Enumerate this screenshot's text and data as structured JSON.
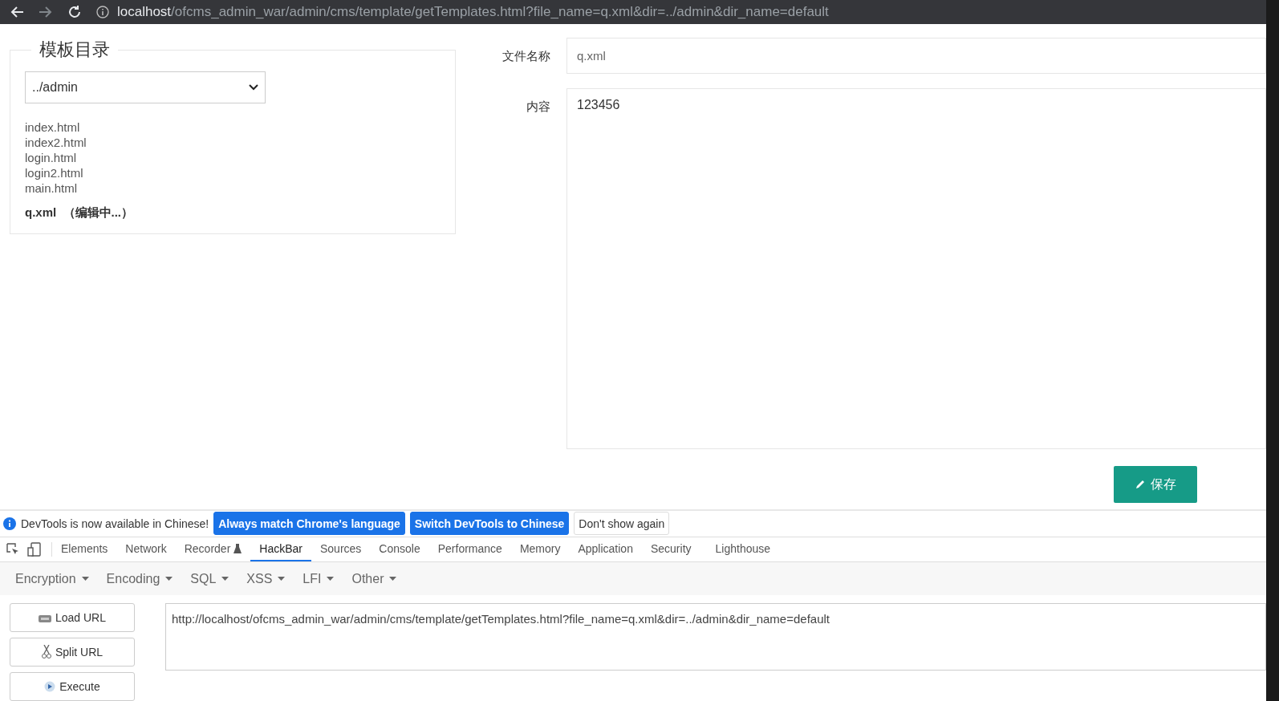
{
  "browser": {
    "url_host": "localhost",
    "url_path": "/ofcms_admin_war/admin/cms/template/getTemplates.html?file_name=q.xml&dir=../admin&dir_name=default"
  },
  "directory_panel": {
    "title": "模板目录",
    "dir_select": "../admin",
    "files": [
      {
        "name": "index.html",
        "editing": false
      },
      {
        "name": "index2.html",
        "editing": false
      },
      {
        "name": "login.html",
        "editing": false
      },
      {
        "name": "login2.html",
        "editing": false
      },
      {
        "name": "main.html",
        "editing": false
      },
      {
        "name": "q.xml",
        "editing": true,
        "status": "（编辑中...）"
      }
    ]
  },
  "editor": {
    "file_name_label": "文件名称",
    "file_name": "q.xml",
    "content_label": "内容",
    "content": "123456",
    "save_button": "保存"
  },
  "devtools": {
    "notice": {
      "text": "DevTools is now available in Chinese!",
      "buttons": [
        {
          "label": "Always match Chrome's language",
          "kind": "primary"
        },
        {
          "label": "Switch DevTools to Chinese",
          "kind": "primary"
        },
        {
          "label": "Don't show again",
          "kind": "plain"
        }
      ]
    },
    "tabs": [
      {
        "label": "Elements",
        "selected": false,
        "experimental": false
      },
      {
        "label": "Network",
        "selected": false,
        "experimental": false
      },
      {
        "label": "Recorder",
        "selected": false,
        "experimental": true
      },
      {
        "label": "HackBar",
        "selected": true,
        "experimental": false
      },
      {
        "label": "Sources",
        "selected": false,
        "experimental": false
      },
      {
        "label": "Console",
        "selected": false,
        "experimental": false
      },
      {
        "label": "Performance",
        "selected": false,
        "experimental": false
      },
      {
        "label": "Memory",
        "selected": false,
        "experimental": false
      },
      {
        "label": "Application",
        "selected": false,
        "experimental": false
      },
      {
        "label": "Security",
        "selected": false,
        "experimental": false
      },
      {
        "label": "Lighthouse",
        "selected": false,
        "experimental": false
      }
    ],
    "hackbar": {
      "menus": [
        "Encryption",
        "Encoding",
        "SQL",
        "XSS",
        "LFI",
        "Other"
      ],
      "actions": [
        {
          "label": "Load URL",
          "kind": "load"
        },
        {
          "label": "Split URL",
          "kind": "split"
        },
        {
          "label": "Execute",
          "kind": "execute"
        }
      ],
      "url": "http://localhost/ofcms_admin_war/admin/cms/template/getTemplates.html?file_name=q.xml&dir=../admin&dir_name=default"
    }
  }
}
